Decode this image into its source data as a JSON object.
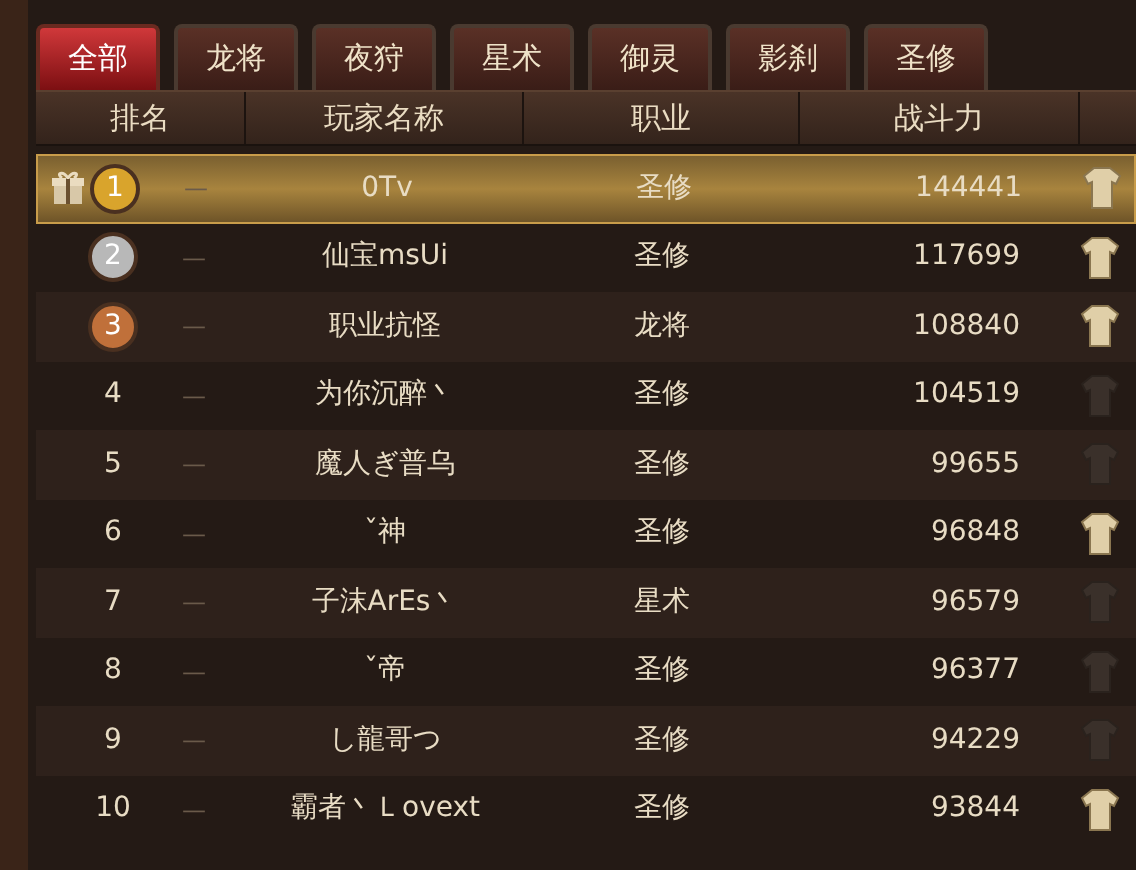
{
  "tabs": [
    {
      "label": "全部",
      "selected": true
    },
    {
      "label": "龙将",
      "selected": false
    },
    {
      "label": "夜狩",
      "selected": false
    },
    {
      "label": "星术",
      "selected": false
    },
    {
      "label": "御灵",
      "selected": false
    },
    {
      "label": "影刹",
      "selected": false
    },
    {
      "label": "圣修",
      "selected": false
    }
  ],
  "table": {
    "columns": [
      "排名",
      "玩家名称",
      "职业",
      "战斗力"
    ],
    "rows": [
      {
        "rank": "1",
        "color": "#d9a42c",
        "gift": true,
        "trend": "—",
        "name": "0Tv",
        "class": "圣修",
        "power": "144441",
        "outfit_lit": true,
        "selected": true
      },
      {
        "rank": "2",
        "color": "#b8b8b8",
        "gift": false,
        "trend": "—",
        "name": "仙宝msUi",
        "class": "圣修",
        "power": "117699",
        "outfit_lit": true,
        "selected": false
      },
      {
        "rank": "3",
        "color": "#c0703a",
        "gift": false,
        "trend": "—",
        "name": "职业抗怪",
        "class": "龙将",
        "power": "108840",
        "outfit_lit": true,
        "selected": false
      },
      {
        "rank": "4",
        "gift": false,
        "trend": "—",
        "name": "为你沉醉丶",
        "class": "圣修",
        "power": "104519",
        "outfit_lit": false,
        "selected": false
      },
      {
        "rank": "5",
        "gift": false,
        "trend": "—",
        "name": "魔人ぎ普乌",
        "class": "圣修",
        "power": "99655",
        "outfit_lit": false,
        "selected": false
      },
      {
        "rank": "6",
        "gift": false,
        "trend": "—",
        "name": "ˇ神",
        "class": "圣修",
        "power": "96848",
        "outfit_lit": true,
        "selected": false
      },
      {
        "rank": "7",
        "gift": false,
        "trend": "—",
        "name": "子沫ArEs丶",
        "class": "星术",
        "power": "96579",
        "outfit_lit": false,
        "selected": false
      },
      {
        "rank": "8",
        "gift": false,
        "trend": "—",
        "name": "ˇ帝",
        "class": "圣修",
        "power": "96377",
        "outfit_lit": false,
        "selected": false
      },
      {
        "rank": "9",
        "gift": false,
        "trend": "—",
        "name": "し龍哥つ",
        "class": "圣修",
        "power": "94229",
        "outfit_lit": false,
        "selected": false
      },
      {
        "rank": "10",
        "gift": false,
        "trend": "—",
        "name": "霸者丶Ｌovext",
        "class": "圣修",
        "power": "93844",
        "outfit_lit": true,
        "selected": false
      }
    ]
  }
}
